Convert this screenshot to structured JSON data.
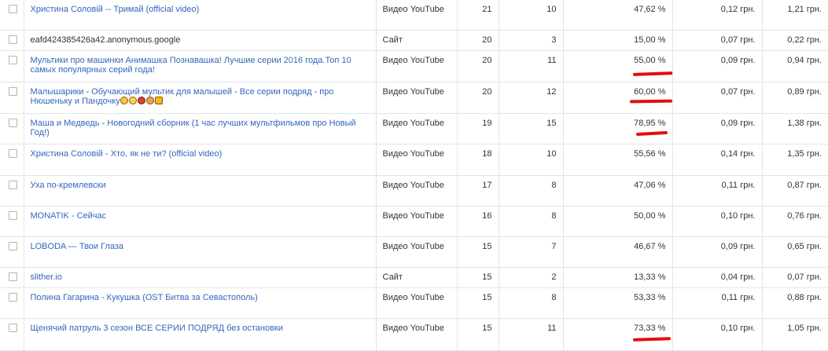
{
  "rows": [
    {
      "title": "Христина Соловій -- Тримай (official video)",
      "type": "Видео YouTube",
      "c1": "21",
      "c2": "10",
      "pct": "47,62 %",
      "p1": "0,12 грн.",
      "p2": "1,21 грн."
    },
    {
      "title": "eafd424385426a42.anonymous.google",
      "type": "Сайт",
      "c1": "20",
      "c2": "3",
      "pct": "15,00 %",
      "p1": "0,07 грн.",
      "p2": "0,22 грн."
    },
    {
      "title": "Мультики про машинки Анимашка Познавашка! Лучшие серии 2016 года.Топ 10 самых популярных серий года!",
      "type": "Видео YouTube",
      "c1": "20",
      "c2": "11",
      "pct": "55,00 %",
      "p1": "0,09 грн.",
      "p2": "0,94 грн."
    },
    {
      "title": "Малышарики - Обучающий мультик для малышей - Все серии подряд - про Нюшеньку и Пандочку",
      "type": "Видео YouTube",
      "c1": "20",
      "c2": "12",
      "pct": "60,00 %",
      "p1": "0,07 грн.",
      "p2": "0,89 грн."
    },
    {
      "title": "Маша и Медведь - Новогодний сборник (1 час лучших мультфильмов про Новый Год!)",
      "type": "Видео YouTube",
      "c1": "19",
      "c2": "15",
      "pct": "78,95 %",
      "p1": "0,09 грн.",
      "p2": "1,38 грн."
    },
    {
      "title": "Христина Соловій - Хто, як не ти? (official video)",
      "type": "Видео YouTube",
      "c1": "18",
      "c2": "10",
      "pct": "55,56 %",
      "p1": "0,14 грн.",
      "p2": "1,35 грн."
    },
    {
      "title": "Уха по-кремлевски",
      "type": "Видео YouTube",
      "c1": "17",
      "c2": "8",
      "pct": "47,06 %",
      "p1": "0,11 грн.",
      "p2": "0,87 грн."
    },
    {
      "title": "MONATIK - Сейчас",
      "type": "Видео YouTube",
      "c1": "16",
      "c2": "8",
      "pct": "50,00 %",
      "p1": "0,10 грн.",
      "p2": "0,76 грн."
    },
    {
      "title": "LOBODA — Твои Глаза",
      "type": "Видео YouTube",
      "c1": "15",
      "c2": "7",
      "pct": "46,67 %",
      "p1": "0,09 грн.",
      "p2": "0,65 грн."
    },
    {
      "title": "slither.io",
      "type": "Сайт",
      "c1": "15",
      "c2": "2",
      "pct": "13,33 %",
      "p1": "0,04 грн.",
      "p2": "0,07 грн."
    },
    {
      "title": "Полина Гагарина - Кукушка (OST Битва за Севастополь)",
      "type": "Видео YouTube",
      "c1": "15",
      "c2": "8",
      "pct": "53,33 %",
      "p1": "0,11 грн.",
      "p2": "0,88 грн."
    },
    {
      "title": "Щенячий патруль 3 сезон ВСЕ СЕРИИ ПОДРЯД без остановки",
      "type": "Видео YouTube",
      "c1": "15",
      "c2": "11",
      "pct": "73,33 %",
      "p1": "0,10 грн.",
      "p2": "1,05 грн."
    }
  ],
  "emoji_icons": [
    "grinning-face-icon",
    "smiling-face-icon",
    "red-mouth-icon",
    "princess-face-icon",
    "yellow-square-icon"
  ],
  "accent_link_color": "#3366bb",
  "highlight_color": "#e01010"
}
